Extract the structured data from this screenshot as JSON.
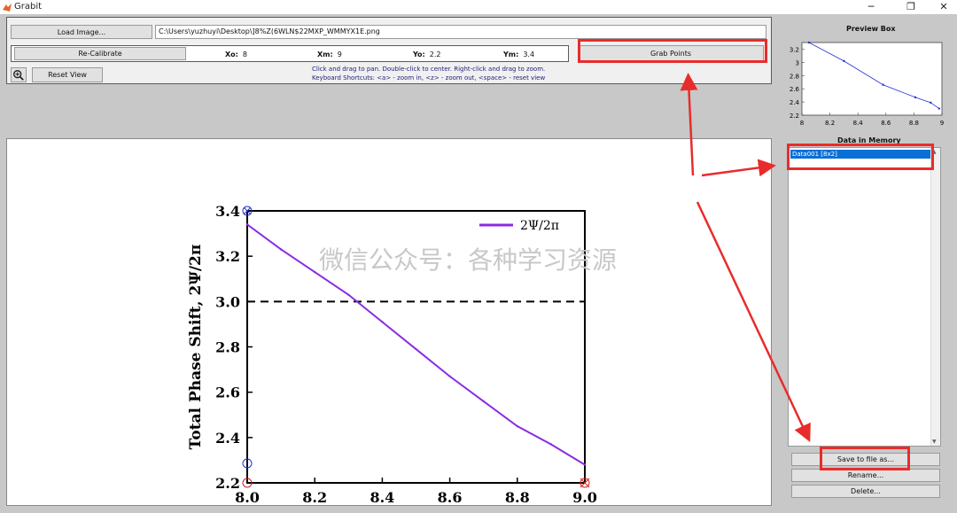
{
  "window": {
    "title": "Grabit",
    "min_icon": "minimize-icon",
    "max_icon": "restore-icon",
    "close_icon": "close-icon"
  },
  "toolbar": {
    "load_label": "Load Image...",
    "image_path": "C:\\Users\\yuzhuyi\\Desktop\\]8%Z(6WLN$22MXP_WMMYX1E.png",
    "recalibrate_label": "Re-Calibrate",
    "grab_label": "Grab Points",
    "reset_label": "Reset View",
    "zoom_icon": "zoom-in-icon"
  },
  "calibration": {
    "xo_label": "Xo:",
    "xo": "8",
    "xm_label": "Xm:",
    "xm": "9",
    "yo_label": "Yo:",
    "yo": "2.2",
    "ym_label": "Ym:",
    "ym": "3.4"
  },
  "instructions": {
    "line1": "Click and drag to pan. Double-click to center. Right-click and drag to zoom.",
    "line2": "Keyboard Shortcuts: <a> - zoom in, <z> - zoom out, <space> - reset view"
  },
  "preview": {
    "title": "Preview Box"
  },
  "memory": {
    "title": "Data in Memory",
    "items": [
      {
        "label": "Data001 [8x2]"
      }
    ],
    "save_label": "Save to file as...",
    "rename_label": "Rename...",
    "delete_label": "Delete..."
  },
  "watermark": "微信公众号：各种学习资源",
  "chart_data": [
    {
      "type": "line",
      "ylabel": "Total Phase Shift, 2Ψ/2π",
      "xlabel": "",
      "x": [
        8.0,
        9.0
      ],
      "series": [
        {
          "name": "2Ψ/2π",
          "color": "#8a2be2",
          "points": [
            [
              8.0,
              3.34
            ],
            [
              8.1,
              3.23
            ],
            [
              8.2,
              3.13
            ],
            [
              8.3,
              3.03
            ],
            [
              8.4,
              2.91
            ],
            [
              8.5,
              2.79
            ],
            [
              8.6,
              2.67
            ],
            [
              8.7,
              2.56
            ],
            [
              8.8,
              2.45
            ],
            [
              8.9,
              2.37
            ],
            [
              9.0,
              2.28
            ]
          ]
        }
      ],
      "reference_line": 3.0,
      "xlim": [
        8.0,
        9.0
      ],
      "ylim": [
        2.2,
        3.4
      ],
      "xticks": [
        "8.0",
        "8.2",
        "8.4",
        "8.6",
        "8.8",
        "9.0"
      ],
      "yticks": [
        "2.2",
        "2.4",
        "2.6",
        "2.8",
        "3.0",
        "3.2",
        "3.4"
      ]
    },
    {
      "type": "scatter",
      "title": "Preview Box",
      "x": [
        8.05,
        8.3,
        8.58,
        8.81,
        8.92,
        8.98
      ],
      "y": [
        3.3,
        3.02,
        2.66,
        2.47,
        2.39,
        2.3
      ],
      "xlim": [
        8,
        9
      ],
      "ylim": [
        2.2,
        3.3
      ],
      "xticks": [
        "8",
        "8.2",
        "8.4",
        "8.6",
        "8.8",
        "9"
      ],
      "yticks": [
        "2.2",
        "2.4",
        "2.6",
        "2.8",
        "3",
        "3.2"
      ]
    }
  ]
}
